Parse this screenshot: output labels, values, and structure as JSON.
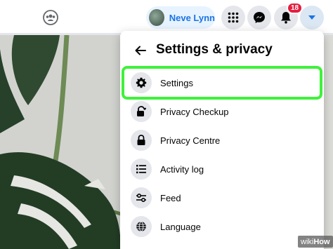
{
  "topbar": {
    "profile_name": "Neve Lynn",
    "notifications_count": "18",
    "icons": [
      "groups-icon",
      "menu-grid-icon",
      "messenger-icon",
      "bell-icon",
      "caret-down-icon"
    ]
  },
  "panel": {
    "title": "Settings & privacy",
    "items": [
      {
        "label": "Settings",
        "icon": "gear-icon"
      },
      {
        "label": "Privacy Checkup",
        "icon": "lock-heart-icon"
      },
      {
        "label": "Privacy Centre",
        "icon": "lock-icon"
      },
      {
        "label": "Activity log",
        "icon": "list-icon"
      },
      {
        "label": "Feed",
        "icon": "sliders-icon"
      },
      {
        "label": "Language",
        "icon": "globe-icon"
      }
    ]
  },
  "watermark": {
    "prefix": "wiki",
    "suffix": "How"
  },
  "colors": {
    "highlight": "#3ef23a",
    "accent": "#1b74e4",
    "badge": "#e41e3f"
  }
}
